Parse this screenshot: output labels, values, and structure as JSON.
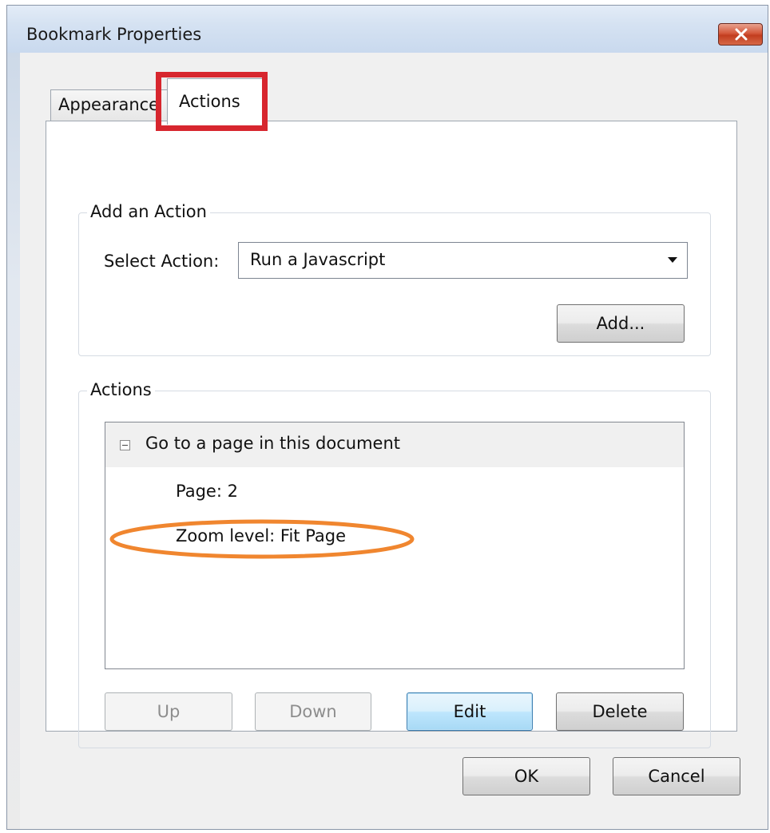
{
  "window": {
    "title": "Bookmark Properties"
  },
  "tabs": [
    {
      "label": "Appearance",
      "active": false
    },
    {
      "label": "Actions",
      "active": true
    }
  ],
  "add_action": {
    "legend": "Add an Action",
    "select_label": "Select Action:",
    "select_value": "Run a Javascript",
    "add_button": "Add..."
  },
  "actions": {
    "legend": "Actions",
    "list": {
      "header": "Go to a page in this document",
      "items": [
        "Page: 2",
        "Zoom level: Fit Page"
      ]
    },
    "buttons": {
      "up": "Up",
      "down": "Down",
      "edit": "Edit",
      "delete": "Delete"
    }
  },
  "footer": {
    "ok": "OK",
    "cancel": "Cancel"
  },
  "colors": {
    "tab_highlight": "#d7262e",
    "annotation_ellipse": "#f0862f",
    "close_button": "#c23d1f"
  },
  "icons": [
    "close-icon",
    "dropdown-arrow-icon",
    "collapse-minus-icon"
  ]
}
